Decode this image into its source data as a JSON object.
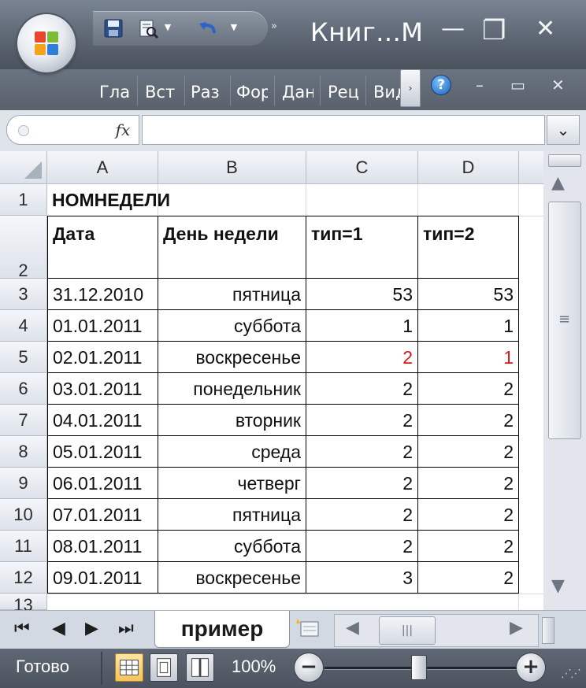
{
  "window": {
    "title": "Книг...М",
    "minimize_glyph": "—",
    "restore_glyph": "❐",
    "close_glyph": "✕"
  },
  "quick_access": {
    "more_glyph": "»"
  },
  "ribbon": {
    "tabs": [
      "Гла",
      "Вст",
      "Раз",
      "Фор",
      "Дан",
      "Рец",
      "Вид"
    ],
    "scroll_glyph": "›",
    "help_glyph": "?",
    "mini_minimize": "–",
    "mini_restore": "▭",
    "mini_close": "✕"
  },
  "formula_bar": {
    "fx_label": "fx",
    "name_box_value": "",
    "formula_value": "",
    "expand_glyph": "⌄"
  },
  "sheet": {
    "columns": [
      "A",
      "B",
      "C",
      "D"
    ],
    "row_numbers": [
      "1",
      "2",
      "3",
      "4",
      "5",
      "6",
      "7",
      "8",
      "9",
      "10",
      "11",
      "12",
      "13"
    ],
    "title": "НОМНЕДЕЛИ",
    "headers": [
      "Дата",
      "День недели",
      "тип=1",
      "тип=2"
    ],
    "rows": [
      {
        "date": "31.12.2010",
        "day": "пятница",
        "type1": "53",
        "type2": "53"
      },
      {
        "date": "01.01.2011",
        "day": "суббота",
        "type1": "1",
        "type2": "1"
      },
      {
        "date": "02.01.2011",
        "day": "воскресенье",
        "type1": "2",
        "type2": "1"
      },
      {
        "date": "03.01.2011",
        "day": "понедельник",
        "type1": "2",
        "type2": "2"
      },
      {
        "date": "04.01.2011",
        "day": "вторник",
        "type1": "2",
        "type2": "2"
      },
      {
        "date": "05.01.2011",
        "day": "среда",
        "type1": "2",
        "type2": "2"
      },
      {
        "date": "06.01.2011",
        "day": "четверг",
        "type1": "2",
        "type2": "2"
      },
      {
        "date": "07.01.2011",
        "day": "пятница",
        "type1": "2",
        "type2": "2"
      },
      {
        "date": "08.01.2011",
        "day": "суббота",
        "type1": "2",
        "type2": "2"
      },
      {
        "date": "09.01.2011",
        "day": "воскресенье",
        "type1": "3",
        "type2": "2"
      }
    ],
    "highlight_row_index": 2,
    "highlight_color": "#d11a1a"
  },
  "sheet_tabs": {
    "active": "пример",
    "nav_first": "⏮",
    "nav_prev": "◀",
    "nav_next": "▶",
    "nav_last": "⏭"
  },
  "scrollbars": {
    "up": "▲",
    "down": "▼",
    "left": "◀",
    "right": "▶",
    "grip": "≡",
    "hgrip": "|||"
  },
  "status_bar": {
    "ready": "Готово",
    "zoom": "100%",
    "zoom_out": "−",
    "zoom_in": "+",
    "grip": "⋰⋰"
  }
}
